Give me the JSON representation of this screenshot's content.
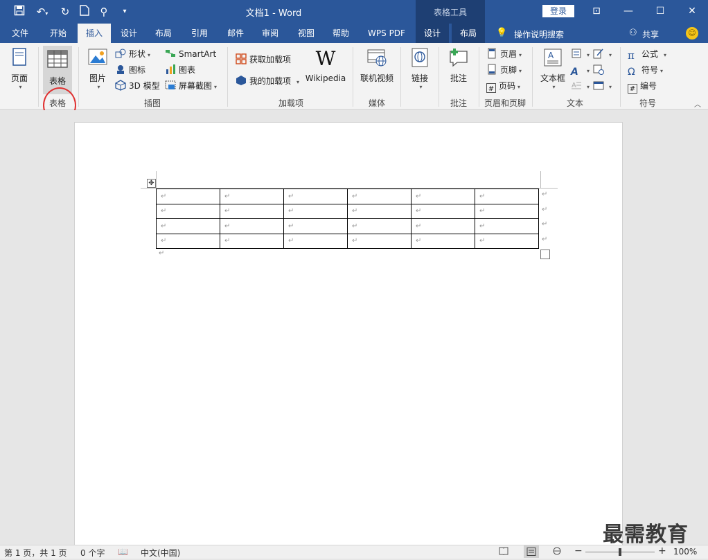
{
  "titlebar": {
    "doc_title": "文档1  -  Word",
    "context_label": "表格工具",
    "login_label": "登录"
  },
  "tabs": [
    "文件",
    "开始",
    "插入",
    "设计",
    "布局",
    "引用",
    "邮件",
    "审阅",
    "视图",
    "帮助",
    "WPS PDF",
    "设计",
    "布局"
  ],
  "active_tab": "插入",
  "tell_me": "操作说明搜索",
  "share": "共享",
  "ribbon": {
    "page": {
      "label": "页面",
      "group": ""
    },
    "table": {
      "label": "表格",
      "group": "表格"
    },
    "illustrations": {
      "group": "插图",
      "pictures": "图片",
      "shapes": "形状",
      "icons": "图标",
      "model3d": "3D 模型",
      "smartart": "SmartArt",
      "chart": "图表",
      "screenshot": "屏幕截图"
    },
    "addins": {
      "group": "加载项",
      "get": "获取加载项",
      "my": "我的加载项",
      "wikipedia": "Wikipedia"
    },
    "media": {
      "group": "媒体",
      "online_video": "联机视频"
    },
    "links": {
      "label": "链接"
    },
    "comments": {
      "group": "批注",
      "comment": "批注"
    },
    "header_footer": {
      "group": "页眉和页脚",
      "header": "页眉",
      "footer": "页脚",
      "page_number": "页码"
    },
    "text": {
      "group": "文本",
      "textbox": "文本框"
    },
    "symbols": {
      "group": "符号",
      "equation": "公式",
      "symbol": "符号",
      "number": "编号"
    }
  },
  "table_cells": [
    [
      "↵",
      "↵",
      "↵",
      "↵",
      "↵",
      "↵"
    ],
    [
      "↵",
      "↵",
      "↵",
      "↵",
      "↵",
      "↵"
    ],
    [
      "↵",
      "↵",
      "↵",
      "↵",
      "↵",
      "↵"
    ],
    [
      "↵",
      "↵",
      "↵",
      "↵",
      "↵",
      "↵"
    ]
  ],
  "statusbar": {
    "page_info": "第 1 页，共 1 页",
    "word_count": "0 个字",
    "language": "中文(中国)",
    "zoom": "100%"
  },
  "watermark": "最需教育",
  "colors": {
    "accent": "#2b579a",
    "context_tab": "#1e3f73",
    "highlight_circle": "#e03030"
  }
}
